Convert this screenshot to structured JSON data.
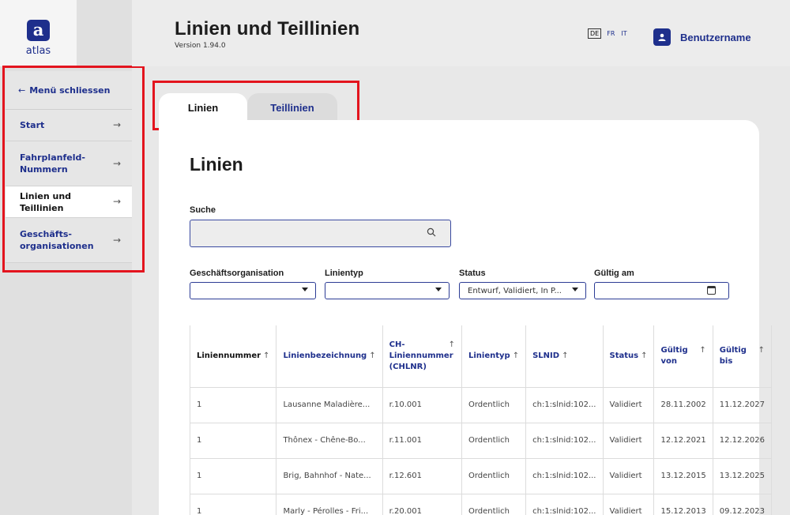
{
  "sidebar": {
    "logo_mark": "a",
    "logo_text": "atlas",
    "close_arrow": "←",
    "close_label": "Menü schliessen",
    "chevron": "→",
    "items": [
      {
        "label": "Start"
      },
      {
        "label": "Fahrplanfeld-Nummern"
      },
      {
        "label": "Linien und Teillinien"
      },
      {
        "label": "Geschäfts-organisationen"
      }
    ]
  },
  "header": {
    "title": "Linien und Teillinien",
    "version": "Version 1.94.0",
    "languages": [
      "DE",
      "FR",
      "IT"
    ],
    "user": "Benutzername"
  },
  "tabs": [
    {
      "label": "Linien"
    },
    {
      "label": "Teillinien"
    }
  ],
  "main": {
    "title": "Linien",
    "search_label": "Suche",
    "search_value": "",
    "filters": {
      "business_org_label": "Geschäftsorganisation",
      "business_org_value": "",
      "line_type_label": "Linientyp",
      "line_type_value": "",
      "status_label": "Status",
      "status_value": "Entwurf, Validiert, In P...",
      "valid_on_label": "Gültig am",
      "valid_on_value": ""
    },
    "sort_icon": "↑",
    "columns": [
      "Liniennummer",
      "Linienbezeichnung",
      "CH-Liniennummer (CHLNR)",
      "Linientyp",
      "SLNID",
      "Status",
      "Gültig von",
      "Gültig bis"
    ],
    "rows": [
      [
        "1",
        "Lausanne Maladière...",
        "r.10.001",
        "Ordentlich",
        "ch:1:slnid:102...",
        "Validiert",
        "28.11.2002",
        "11.12.2027"
      ],
      [
        "1",
        "Thônex - Chêne-Bo...",
        "r.11.001",
        "Ordentlich",
        "ch:1:slnid:102...",
        "Validiert",
        "12.12.2021",
        "12.12.2026"
      ],
      [
        "1",
        "Brig, Bahnhof - Nate...",
        "r.12.601",
        "Ordentlich",
        "ch:1:slnid:102...",
        "Validiert",
        "13.12.2015",
        "13.12.2025"
      ],
      [
        "1",
        "Marly - Pérolles - Fri...",
        "r.20.001",
        "Ordentlich",
        "ch:1:slnid:102...",
        "Validiert",
        "15.12.2013",
        "09.12.2023"
      ]
    ]
  },
  "colors": {
    "brand": "#1e2f8c",
    "highlight": "#e3141e"
  }
}
